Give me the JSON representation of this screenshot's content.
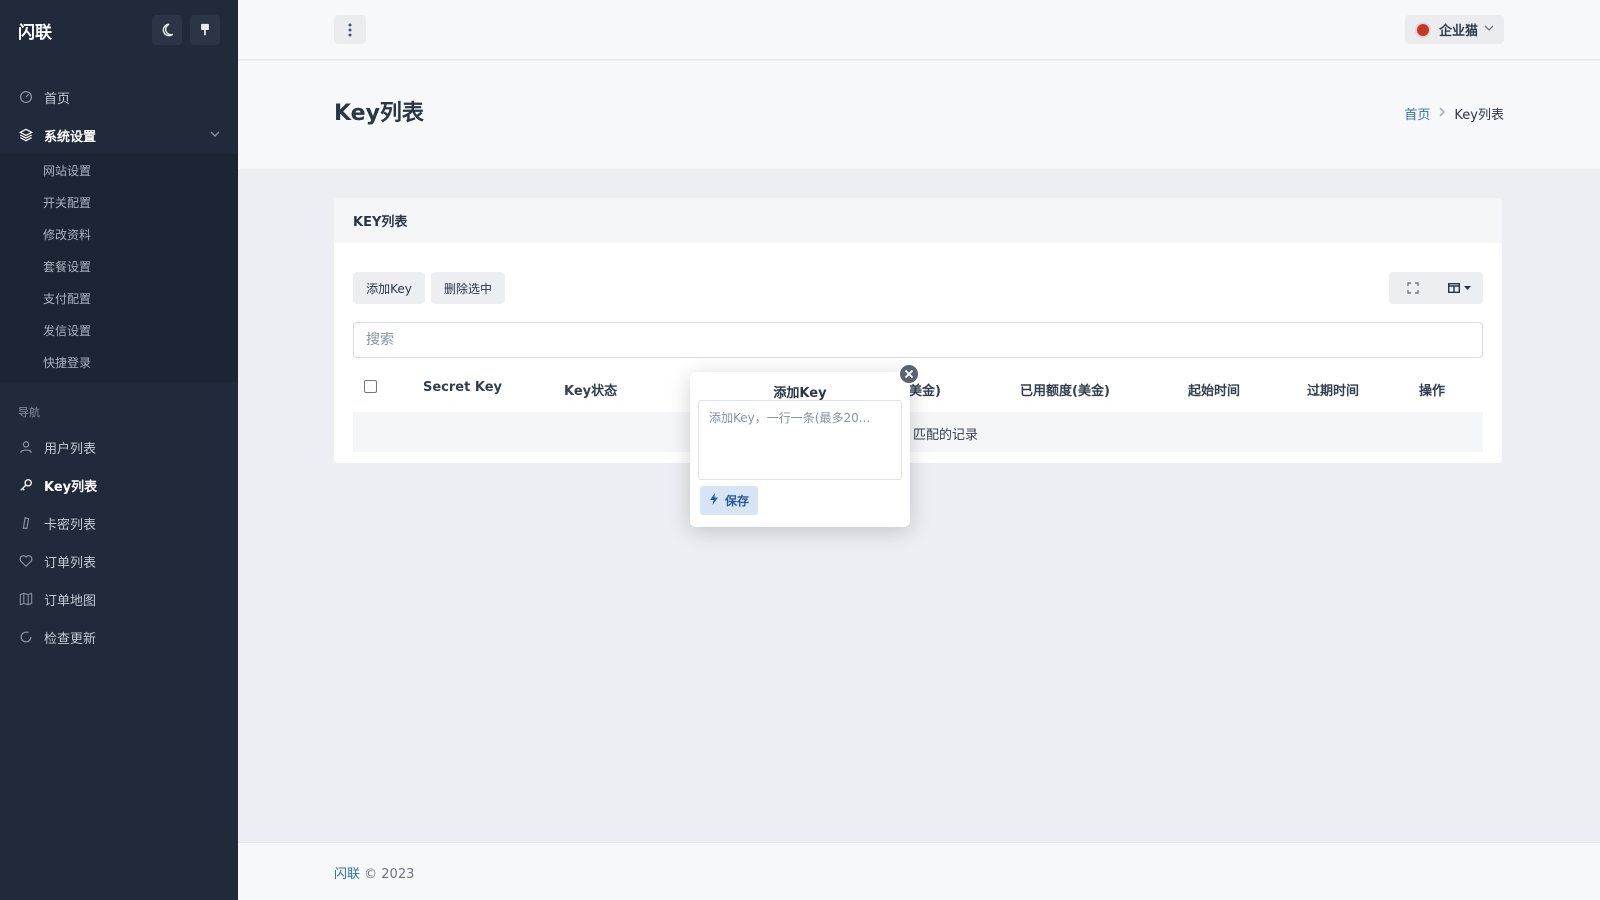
{
  "sidebar": {
    "title": "闪联",
    "items": [
      {
        "label": "首页"
      },
      {
        "label": "系统设置"
      }
    ],
    "sub_items": [
      {
        "label": "网站设置"
      },
      {
        "label": "开关配置"
      },
      {
        "label": "修改资料"
      },
      {
        "label": "套餐设置"
      },
      {
        "label": "支付配置"
      },
      {
        "label": "发信设置"
      },
      {
        "label": "快捷登录"
      }
    ],
    "section_label": "导航",
    "nav_items": [
      {
        "label": "用户列表"
      },
      {
        "label": "Key列表"
      },
      {
        "label": "卡密列表"
      },
      {
        "label": "订单列表"
      },
      {
        "label": "订单地图"
      },
      {
        "label": "检查更新"
      }
    ]
  },
  "topbar": {
    "user_name": "企业猫"
  },
  "page": {
    "title": "Key列表",
    "breadcrumb": {
      "home": "首页",
      "current": "Key列表"
    }
  },
  "card": {
    "title": "KEY列表",
    "add_label": "添加Key",
    "delete_label": "删除选中",
    "search_placeholder": "搜索",
    "columns": [
      "Secret Key",
      "Key状态",
      "(美金)",
      "已用额度(美金)",
      "起始时间",
      "过期时间",
      "操作"
    ],
    "empty_text": "匹配的记录"
  },
  "modal": {
    "title": "添加Key",
    "placeholder": "添加Key，一行一条(最多20...",
    "save_label": "保存"
  },
  "footer": {
    "brand": "闪联",
    "copyright": "© 2023"
  },
  "colors": {
    "sidebar_bg": "#202a3a",
    "accent": "#2f6fb3",
    "page_bg": "#eceef3"
  }
}
